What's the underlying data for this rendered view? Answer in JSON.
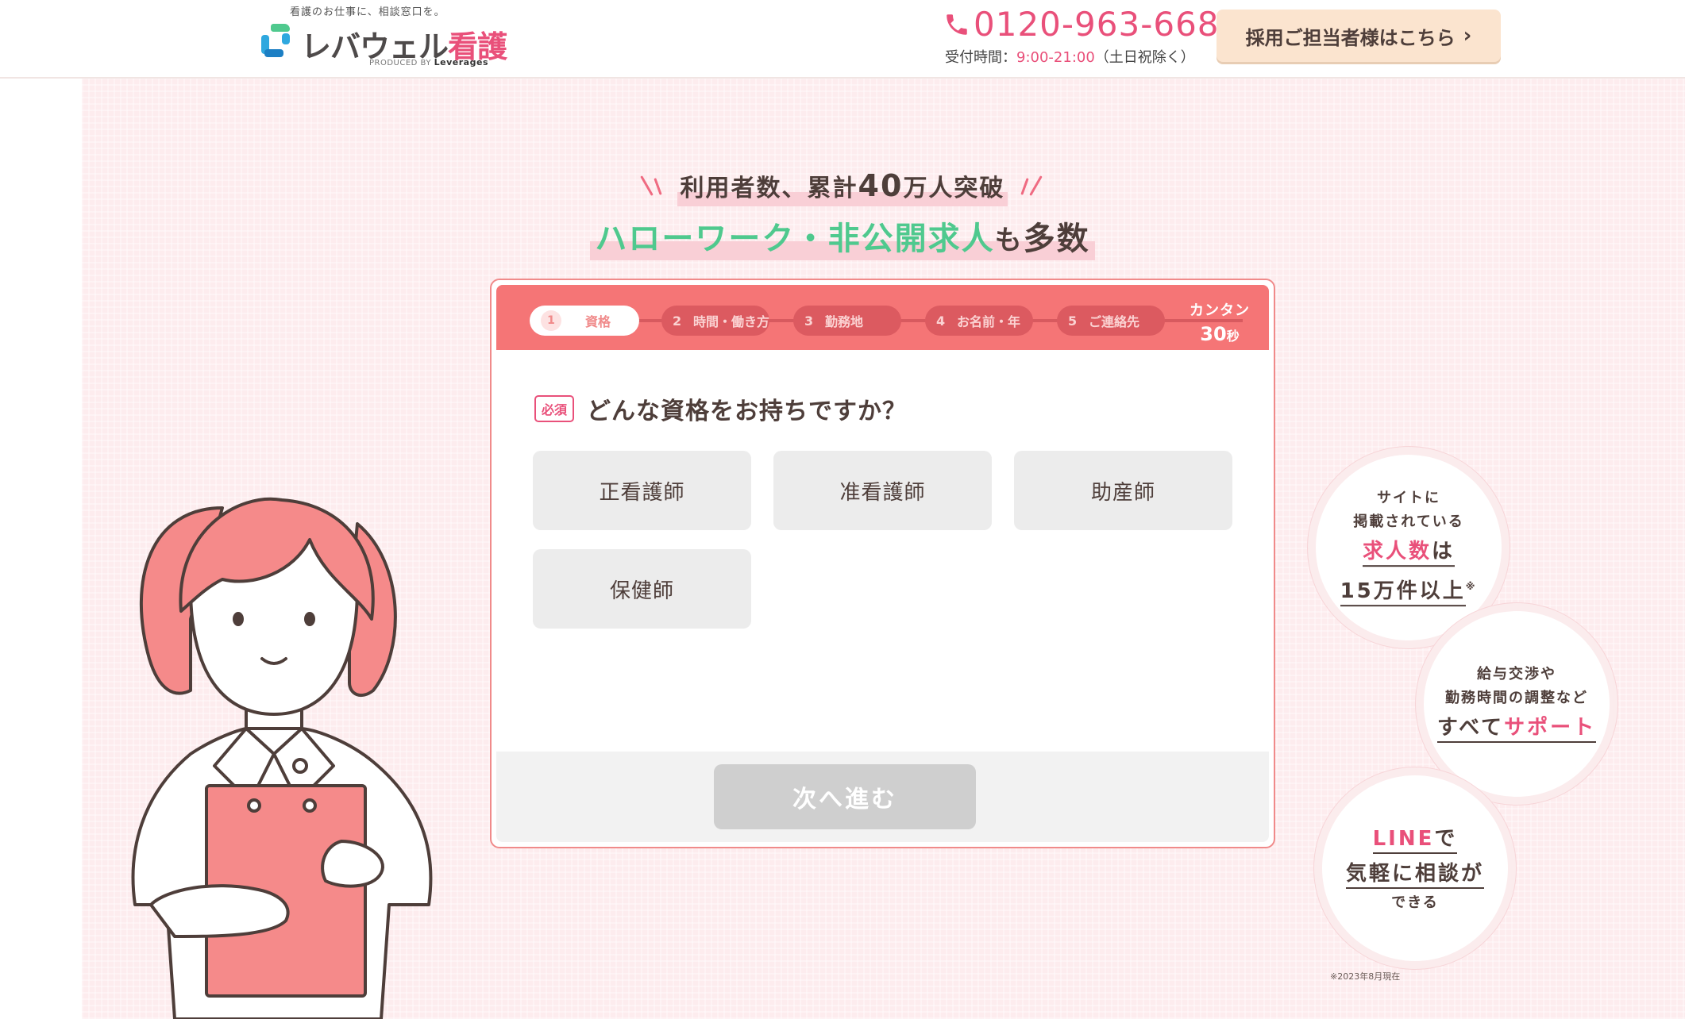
{
  "header": {
    "tagline": "看護のお仕事に、相談窓口を。",
    "logo_main": "レバウェル",
    "logo_accent": "看護",
    "produced_prefix": "PRODUCED BY ",
    "produced_brand": "Leverages",
    "phone_number": "0120-963-668",
    "hours_label": "受付時間：",
    "hours_time": "9:00-21:00",
    "hours_note": "（土日祝除く）",
    "recruit_button": "採用ご担当者様はこちら",
    "recruit_chevron": "›"
  },
  "hero": {
    "headline1_a": "利用者数、累計",
    "headline1_num": "40",
    "headline1_b": "万人突破",
    "headline2_green": "ハローワーク・非公開求人",
    "headline2_suffix_small": "も",
    "headline2_suffix": "多数"
  },
  "form": {
    "steps": [
      {
        "num": "1",
        "label": "資格"
      },
      {
        "num": "2",
        "label": "時間・働き方"
      },
      {
        "num": "3",
        "label": "勤務地"
      },
      {
        "num": "4",
        "label": "お名前・年"
      },
      {
        "num": "5",
        "label": "ご連絡先"
      }
    ],
    "active_step": 1,
    "quick_top": "カンタン",
    "quick_num": "30",
    "quick_unit": "秒",
    "required_badge": "必須",
    "question": "どんな資格をお持ちですか？",
    "options": [
      "正看護師",
      "准看護師",
      "助産師",
      "保健師"
    ],
    "next_button": "次へ進む"
  },
  "features": {
    "b1_l1": "サイトに",
    "b1_l2": "掲載されている",
    "b1_l3_pink": "求人数",
    "b1_l3": "は",
    "b1_l4": "15万件以上",
    "b1_mark": "※",
    "b2_l1": "給与交渉や",
    "b2_l2": "勤務時間の調整など",
    "b2_l3": "すべて",
    "b2_l3_pink": "サポート",
    "b3_l1_pink": "LINE",
    "b3_l1": "で",
    "b3_l2": "気軽に相談が",
    "b3_l3": "できる",
    "note": "※2023年8月現在"
  },
  "colors": {
    "brand_pink": "#e9507a",
    "green": "#4fc98e",
    "step_bar": "#f57576",
    "hero_bg": "#fdecee",
    "recruit_bg": "#fbe4cf"
  },
  "icons": [
    "phone-icon",
    "chevron-right-icon",
    "logo-mark-icon",
    "sparkle-icon"
  ]
}
